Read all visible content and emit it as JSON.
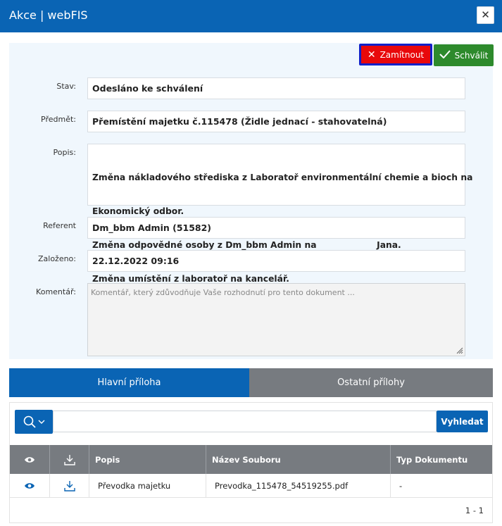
{
  "window": {
    "title": "Akce | webFIS",
    "close": "✕"
  },
  "actions": {
    "reject_label": "Zamítnout",
    "approve_label": "Schválit"
  },
  "form": {
    "status": {
      "label": "Stav:",
      "value": "Odesláno ke schválení"
    },
    "subject": {
      "label": "Předmět:",
      "value": "Přemístění majetku č.115478 (Židle jednací - stahovatelná)"
    },
    "description": {
      "label": "Popis:",
      "line1": "Změna nákladového střediska z Laboratoř environmentální chemie a bioch na",
      "line2": "Ekonomický odbor.",
      "line3": "Změna odpovědné osoby z Dm_bbm Admin na                    Jana.",
      "line4": "Změna umístění z laboratoř na kancelář."
    },
    "referent": {
      "label": "Referent",
      "value": "Dm_bbm Admin (51582)"
    },
    "created": {
      "label": "Založeno:",
      "value": "22.12.2022 09:16"
    },
    "comment": {
      "label": "Komentář:",
      "placeholder": "Komentář, který zdůvodňuje Vaše rozhodnutí pro tento dokument ..."
    }
  },
  "tabs": {
    "main": "Hlavní příloha",
    "other": "Ostatní přílohy"
  },
  "attachments": {
    "search_button": "Vyhledat",
    "columns": {
      "popis": "Popis",
      "nazev": "Název Souboru",
      "typ": "Typ Dokumentu"
    },
    "rows": [
      {
        "popis": "Převodka majetku",
        "nazev": "Prevodka_115478_54519255.pdf",
        "typ": "-"
      }
    ],
    "pagination": "1 - 1"
  },
  "colors": {
    "primary": "#0a64b4",
    "danger": "#e8080b",
    "success": "#2d8a2c",
    "header_gray": "#777b80"
  }
}
